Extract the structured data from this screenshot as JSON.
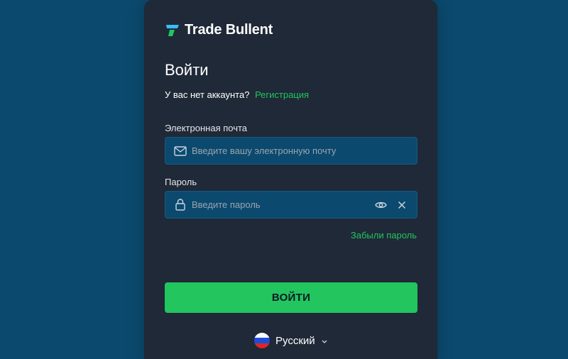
{
  "brand": {
    "name": "Trade Bullent"
  },
  "form": {
    "title": "Войти",
    "signup_prompt": "У вас нет аккаунта?",
    "signup_link": "Регистрация",
    "email": {
      "label": "Электронная почта",
      "placeholder": "Введите вашу электронную почту",
      "value": ""
    },
    "password": {
      "label": "Пароль",
      "placeholder": "Введите пароль",
      "value": ""
    },
    "forgot_link": "Забыли пароль",
    "submit_label": "ВОЙТИ"
  },
  "language": {
    "selected": "Русский"
  },
  "colors": {
    "background": "#0b4a6e",
    "card": "#1f2937",
    "accent": "#22c55e",
    "field_bg": "#0b4a6e"
  },
  "icons": {
    "logo": "trade-bullent-logo-icon",
    "email": "mail-icon",
    "password": "lock-icon",
    "show_password": "eye-icon",
    "clear": "close-icon",
    "language_flag": "russia-flag-icon",
    "language_caret": "chevron-down-icon"
  }
}
